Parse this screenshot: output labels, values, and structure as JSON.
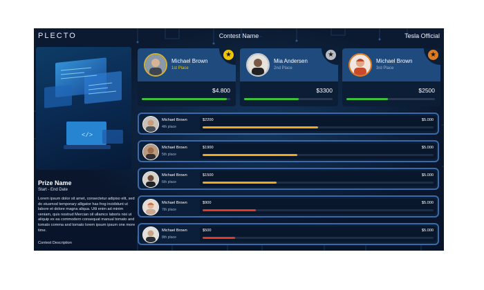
{
  "header": {
    "logo": "PLECTO",
    "contest_name": "Contest Name",
    "organization": "Tesla Official"
  },
  "prize": {
    "name": "Prize Name",
    "dates": "Start - End Date",
    "description": "Lorem ipsum dolor sit amet, consectetur adipiso elit, sed do eiusmod temporary alligator has frog incididunt ut labore et dolore magna aliqua. Utli enim ad minim veniam, quis nostrud Mercian oil ullamco laboris nisi ut aliquip ex ea commodern consequat manual tomato and tomato comma and tomato lorem ipsum ipsum one more time.",
    "description_label": "Contest Description"
  },
  "top3": [
    {
      "name": "Michael Brown",
      "place": "1st Place",
      "amount": "$4.800",
      "progress": 0.96,
      "badge_icon": "gold-star-icon",
      "badge_color": "#f0c400"
    },
    {
      "name": "Mia Andersen",
      "place": "2nd Place",
      "amount": "$3300",
      "progress": 0.62,
      "badge_icon": "silver-star-icon",
      "badge_color": "#b8bcc4"
    },
    {
      "name": "Michael Brown",
      "place": "3rd Place",
      "amount": "$2500",
      "progress": 0.47,
      "badge_icon": "bronze-star-icon",
      "badge_color": "#e07a1f"
    }
  ],
  "rows": [
    {
      "name": "Michael Brown",
      "place": "4th place",
      "amount": "$2200",
      "target": "$5.000",
      "progress": 0.5,
      "color": "#f0a81c"
    },
    {
      "name": "Michael Brown",
      "place": "5th place",
      "amount": "$1900",
      "target": "$5.000",
      "progress": 0.41,
      "color": "#f0a81c"
    },
    {
      "name": "Michael Brown",
      "place": "6th place",
      "amount": "$1500",
      "target": "$5.000",
      "progress": 0.32,
      "color": "#f0a81c"
    },
    {
      "name": "Michael Brown",
      "place": "7th place",
      "amount": "$900",
      "target": "$5.000",
      "progress": 0.23,
      "color": "#e23a28"
    },
    {
      "name": "Michael Brown",
      "place": "8th place",
      "amount": "$500",
      "target": "$5.000",
      "progress": 0.14,
      "color": "#e23a28"
    }
  ]
}
